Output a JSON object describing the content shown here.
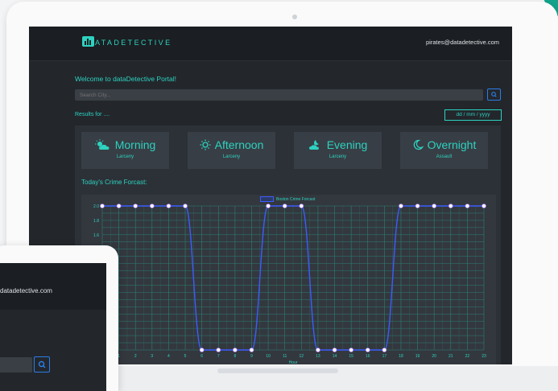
{
  "nav": {
    "brand": "ATADETECTIVE",
    "user_email": "pirates@datadetective.com"
  },
  "welcome": "Welcome to dataDetective Portal!",
  "search": {
    "placeholder": "Search City..."
  },
  "results_label": "Results for ....",
  "date_placeholder": "dd / mm / yyyy",
  "cards": [
    {
      "title": "Morning",
      "crime": "Larceny",
      "icon": "cloud-sun-icon"
    },
    {
      "title": "Afternoon",
      "crime": "Larceny",
      "icon": "sun-icon"
    },
    {
      "title": "Evening",
      "crime": "Larceny",
      "icon": "sunset-cloud-icon"
    },
    {
      "title": "Overnight",
      "crime": "Assault",
      "icon": "moon-icon"
    }
  ],
  "forecast_title": "Today's Crime Forcast:",
  "chart_data": {
    "type": "line",
    "legend": "Boston Crime Forcast",
    "xlabel": "Hour",
    "x": [
      0,
      1,
      2,
      3,
      4,
      5,
      6,
      7,
      8,
      9,
      10,
      11,
      12,
      13,
      14,
      15,
      16,
      17,
      18,
      19,
      20,
      21,
      22,
      23
    ],
    "values": [
      2,
      2,
      2,
      2,
      2,
      2,
      0,
      0,
      0,
      0,
      2,
      2,
      2,
      0,
      0,
      0,
      0,
      0,
      2,
      2,
      2,
      2,
      2,
      2
    ],
    "ylim": [
      0,
      2
    ],
    "yticks": [
      "2.0",
      "1.8",
      "1.6",
      "1.4"
    ],
    "grid": true,
    "colors": {
      "line": "#3d5cff",
      "point": "#ffffff",
      "grid": "#2a7f75",
      "tick": "#2dd2c0"
    }
  },
  "secondary": {
    "user_email": "datadetective.com"
  },
  "colors": {
    "accent": "#2dd2c0",
    "button": "#2b7de9",
    "background": "#23272c"
  }
}
